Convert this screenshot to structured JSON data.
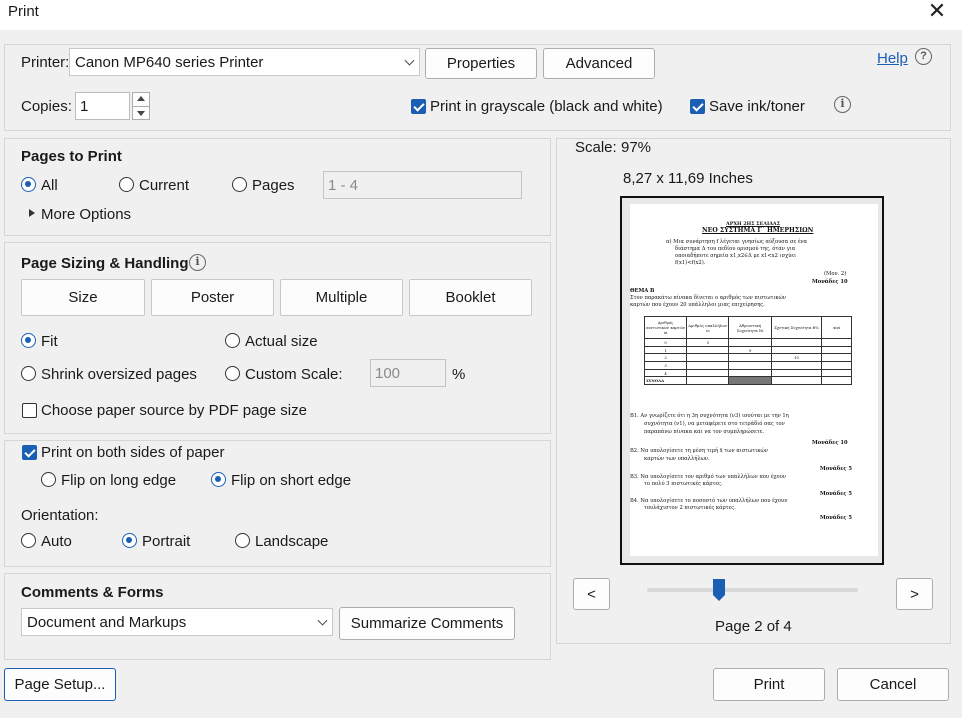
{
  "window": {
    "title": "Print"
  },
  "printer": {
    "label": "Printer:",
    "selected": "Canon MP640 series Printer",
    "properties_label": "Properties",
    "advanced_label": "Advanced",
    "help_label": "Help"
  },
  "copies": {
    "label": "Copies:",
    "value": "1",
    "grayscale_label": "Print in grayscale (black and white)",
    "grayscale_checked": true,
    "save_ink_label": "Save ink/toner",
    "save_ink_checked": true
  },
  "pages_to_print": {
    "heading": "Pages to Print",
    "options": [
      "All",
      "Current",
      "Pages"
    ],
    "selected": "All",
    "pages_placeholder": "1 - 4",
    "more_options": "More Options"
  },
  "page_sizing": {
    "heading": "Page Sizing & Handling",
    "tabs": [
      "Size",
      "Poster",
      "Multiple",
      "Booklet"
    ],
    "fit_label": "Fit",
    "actual_size_label": "Actual size",
    "shrink_label": "Shrink oversized pages",
    "custom_scale_label": "Custom Scale:",
    "custom_scale_value": "100",
    "percent": "%",
    "selected": "Fit",
    "paper_source_label": "Choose paper source by PDF page size"
  },
  "duplex": {
    "both_sides_label": "Print on both sides of paper",
    "both_sides_checked": true,
    "flip_long": "Flip on long edge",
    "flip_short": "Flip on short edge",
    "flip_selected": "short"
  },
  "orientation": {
    "label": "Orientation:",
    "options": [
      "Auto",
      "Portrait",
      "Landscape"
    ],
    "selected": "Portrait"
  },
  "comments_forms": {
    "heading": "Comments & Forms",
    "selected": "Document and Markups",
    "summarize_label": "Summarize Comments"
  },
  "preview": {
    "scale_label": "Scale:",
    "scale_value": "97%",
    "dimensions": "8,27 x 11,69 Inches",
    "prev": "<",
    "next": ">",
    "page_indicator": "Page 2 of 4",
    "slider_fraction": 0.34,
    "doc": {
      "header": "ΑΡΧΗ 2ΗΣ ΣΕΛΙΔΑΣ",
      "subheader": "ΝΕΟ ΣΥΣΤΗΜΑ Γ΄ ΗΜΕΡΗΣΙΩΝ",
      "a_lines": [
        "α) Μια συνάρτηση f λέγεται γνησίως αύξουσα σε ένα",
        "διάστημα Δ του πεδίου ορισμού της, όταν για",
        "οποιαδήποτε σημεία x1,x2∈Δ με x1<x2 ισχύει",
        "f(x1)<f(x2)."
      ],
      "mov2": "(Μον. 2)",
      "monades10a": "Μονάδες 10",
      "thema": "ΘΕΜΑ Β",
      "intro": [
        "Στον παρακάτω πίνακα δίνεται ο αριθμός των πιστωτικών",
        "καρτών που έχουν 20 υπάλληλοι μιας επιχείρησης."
      ],
      "table_headers": [
        "Αριθμός πιστωτικών καρτών xi",
        "Αριθμός υπαλλήλων νi",
        "Αθροιστική Συχνότητα Νi",
        "Σχετική Συχνότητα fi%",
        "xiνi"
      ],
      "table_rows": [
        [
          "0",
          "5",
          "",
          "",
          ""
        ],
        [
          "1",
          "",
          "9",
          "",
          ""
        ],
        [
          "2",
          "",
          "",
          "10",
          ""
        ],
        [
          "3",
          "",
          "",
          "",
          ""
        ],
        [
          "4",
          "",
          "",
          "",
          ""
        ],
        [
          "ΣΥΝΟΛΑ",
          "",
          "",
          "",
          ""
        ]
      ],
      "b1": [
        "Β1. Αν γνωρίζετε ότι η 3η συχνότητα (ν3) ισούται με την 1η",
        "συχνότητα (ν1), να μεταφέρετε στο τετράδιό σας τον",
        "παραπάνω πίνακα και να τον συμπληρώσετε."
      ],
      "monades10b": "Μονάδες 10",
      "b2": [
        "Β2. Να υπολογίσετε τη μέση τιμή x̄ των πιστωτικών",
        "καρτών των υπαλλήλων."
      ],
      "monades5a": "Μονάδες 5",
      "b3": [
        "Β3. Να υπολογίσετε τον αριθμό των υπαλλήλων που έχουν",
        "το πολύ 3 πιστωτικές κάρτες."
      ],
      "monades5b": "Μονάδες 5",
      "b4": [
        "Β4. Να υπολογίσετε το ποσοστό των υπαλλήλων που έχουν",
        "τουλάχιστον 2 πιστωτικές κάρτες."
      ],
      "monades5c": "Μονάδες 5"
    }
  },
  "footer": {
    "page_setup": "Page Setup...",
    "print": "Print",
    "cancel": "Cancel"
  },
  "colors": {
    "accent": "#1a5fb4",
    "background": "#f0f0f0"
  }
}
